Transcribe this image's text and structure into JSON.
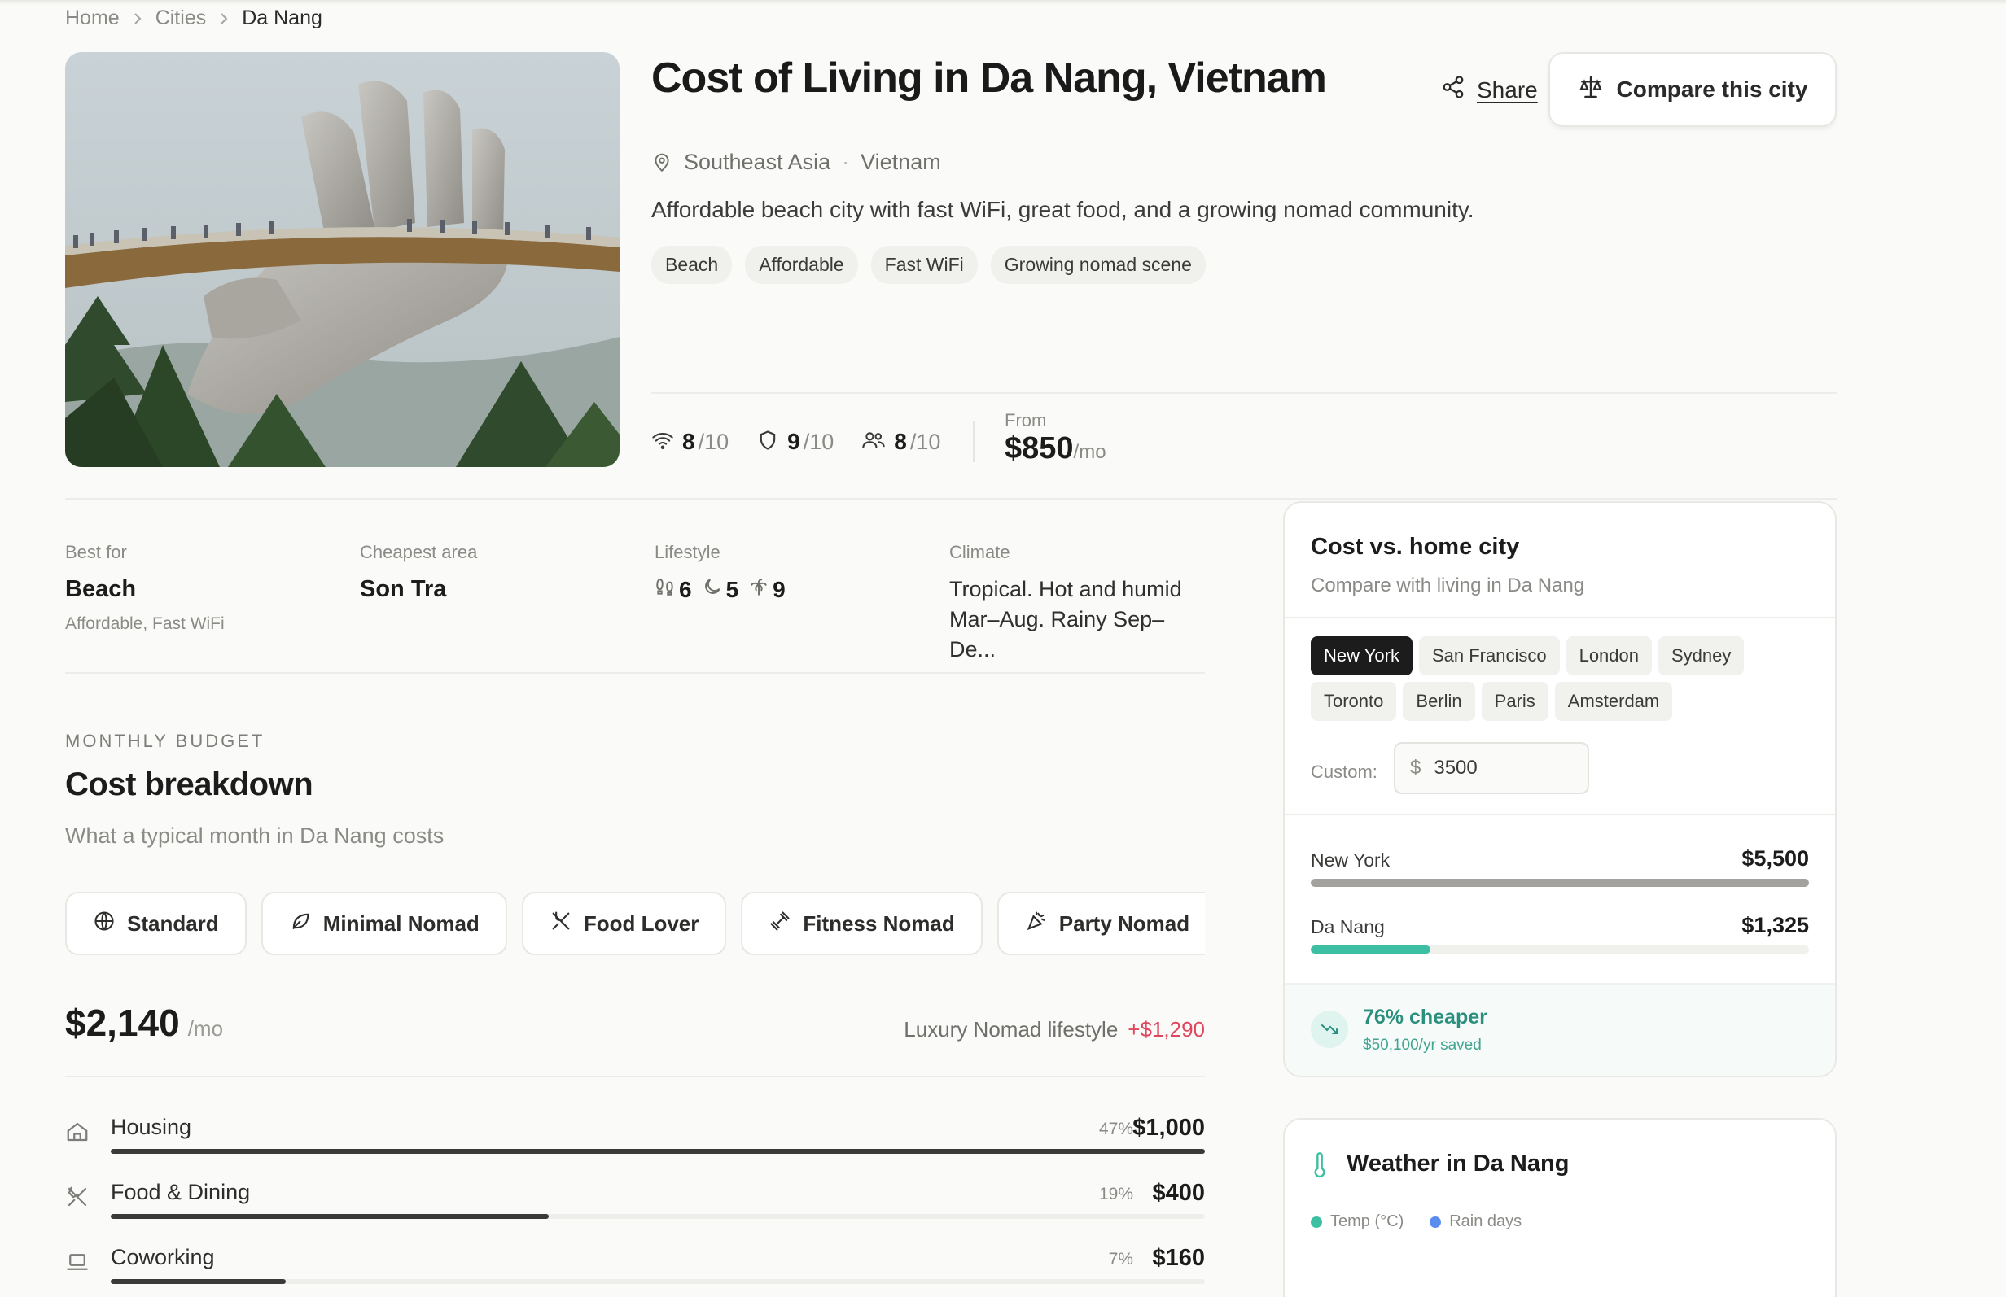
{
  "breadcrumb": {
    "home": "Home",
    "cities": "Cities",
    "current": "Da Nang"
  },
  "hero": {
    "title": "Cost of Living in Da Nang, Vietnam",
    "share_label": "Share",
    "compare_label": "Compare this city",
    "region": "Southeast Asia",
    "country": "Vietnam",
    "description": "Affordable beach city with fast WiFi, great food, and a growing nomad community.",
    "tags": [
      "Beach",
      "Affordable",
      "Fast WiFi",
      "Growing nomad scene"
    ],
    "ratings": [
      {
        "icon": "wifi-icon",
        "value": "8",
        "max": "/10"
      },
      {
        "icon": "shield-icon",
        "value": "9",
        "max": "/10"
      },
      {
        "icon": "people-icon",
        "value": "8",
        "max": "/10"
      }
    ],
    "from_label": "From",
    "from_price": "$850",
    "from_per": "/mo"
  },
  "info": {
    "best_for_label": "Best for",
    "best_for_value": "Beach",
    "best_for_sub": "Affordable, Fast WiFi",
    "cheapest_label": "Cheapest area",
    "cheapest_value": "Son Tra",
    "lifestyle_label": "Lifestyle",
    "lifestyle_values": [
      {
        "icon": "footprints-icon",
        "value": "6"
      },
      {
        "icon": "moon-icon",
        "value": "5"
      },
      {
        "icon": "palm-tree-icon",
        "value": "9"
      }
    ],
    "climate_label": "Climate",
    "climate_text": "Tropical. Hot and humid Mar–Aug. Rainy Sep–De..."
  },
  "budget": {
    "eyebrow": "MONTHLY BUDGET",
    "title": "Cost breakdown",
    "subtitle": "What a typical month in Da Nang costs",
    "presets": [
      {
        "label": "Standard",
        "icon": "globe-icon"
      },
      {
        "label": "Minimal Nomad",
        "icon": "leaf-icon"
      },
      {
        "label": "Food Lover",
        "icon": "utensils-icon"
      },
      {
        "label": "Fitness Nomad",
        "icon": "dumbbell-icon"
      },
      {
        "label": "Party Nomad",
        "icon": "party-popper-icon"
      }
    ],
    "total": "$2,140",
    "total_per": "/mo",
    "lifestyle_note": "Luxury Nomad lifestyle",
    "lifestyle_delta": "+$1,290",
    "categories": [
      {
        "name": "Housing",
        "pct": "47%",
        "amount": "$1,000",
        "fraction": 1.0,
        "icon": "home-icon"
      },
      {
        "name": "Food & Dining",
        "pct": "19%",
        "amount": "$400",
        "fraction": 0.4,
        "icon": "utensils-crossed-icon"
      },
      {
        "name": "Coworking",
        "pct": "7%",
        "amount": "$160",
        "fraction": 0.16,
        "icon": "laptop-icon"
      }
    ]
  },
  "compare": {
    "title": "Cost vs. home city",
    "subtitle": "Compare with living in Da Nang",
    "cities": [
      "New York",
      "San Francisco",
      "London",
      "Sydney",
      "Toronto",
      "Berlin",
      "Paris",
      "Amsterdam"
    ],
    "active_city": "New York",
    "custom_label": "Custom:",
    "custom_currency": "$",
    "custom_value": "3500",
    "rows": [
      {
        "city": "New York",
        "price": "$5,500",
        "fraction": 1.0,
        "color": "#a3a29f"
      },
      {
        "city": "Da Nang",
        "price": "$1,325",
        "fraction": 0.24,
        "color": "#3dbfa3"
      }
    ],
    "savings_main": "76% cheaper",
    "savings_sub": "$50,100/yr saved"
  },
  "weather": {
    "title": "Weather in Da Nang",
    "legend": [
      {
        "label": "Temp (°C)",
        "color": "#3dbfa3"
      },
      {
        "label": "Rain days",
        "color": "#5b8def"
      }
    ]
  }
}
